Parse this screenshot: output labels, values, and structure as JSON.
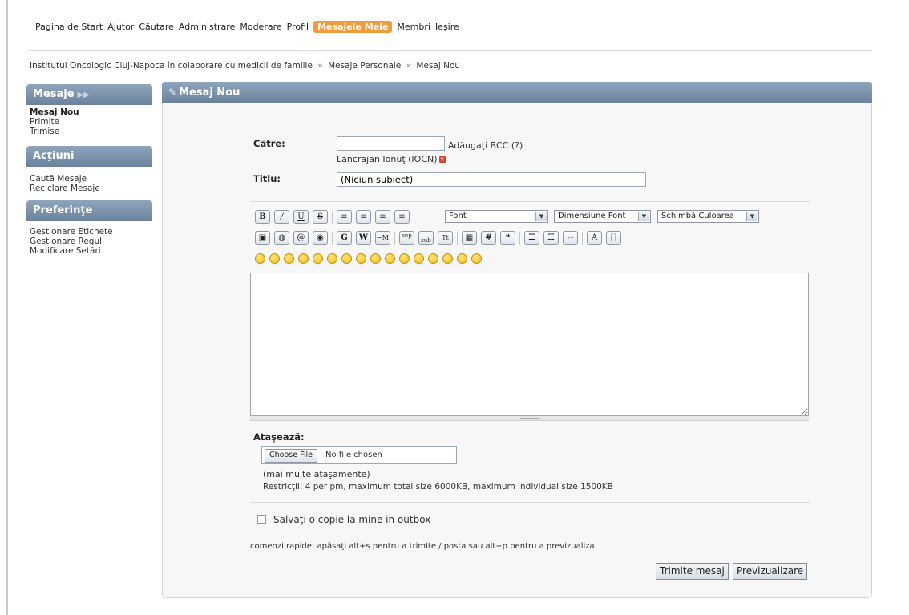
{
  "nav": {
    "items": [
      {
        "label": "Pagina de Start"
      },
      {
        "label": "Ajutor"
      },
      {
        "label": "Căutare"
      },
      {
        "label": "Administrare"
      },
      {
        "label": "Moderare"
      },
      {
        "label": "Profil"
      },
      {
        "label": "Mesajele Mele",
        "active": true
      },
      {
        "label": "Membri"
      },
      {
        "label": "Ieşire"
      }
    ],
    "accent_color": "#f39a3a"
  },
  "breadcrumb": {
    "items": [
      "Institutul Oncologic Cluj-Napoca în colaborare cu medicii de familie",
      "Mesaje Personale",
      "Mesaj Nou"
    ],
    "separator": "»"
  },
  "sidebar": {
    "sections": [
      {
        "title": "Mesaje",
        "items": [
          "Mesaj Nou",
          "Primite",
          "Trimise"
        ]
      },
      {
        "title": "Acţiuni",
        "items": [
          "Caută Mesaje",
          "Reciclare Mesaje"
        ]
      },
      {
        "title": "Preferinţe",
        "items": [
          "Gestionare Etichete",
          "Gestionare Reguli",
          "Modificare Setări"
        ]
      }
    ],
    "header_color": "#7d93ab"
  },
  "main": {
    "title": "Mesaj Nou",
    "to_label": "Către:",
    "to_value": "",
    "add_bcc": "Adăugaţi BCC (?)",
    "recipient": "Lăncrăjan Ionuţ (IOCN)",
    "subject_label": "Titlu:",
    "subject_value": "(Niciun subiect)",
    "toolbar": {
      "font_select": "Font",
      "size_select": "Dimensiune Font",
      "color_select": "Schimbă Culoarea"
    },
    "body_value": "",
    "attach_label": "Ataşează:",
    "choose_file": "Choose File",
    "no_file": "No file chosen",
    "more_attachments": "(mai multe ataşamente)",
    "restrictions": "Restricţii: 4 per pm, maximum total size 6000KB, maximum individual size 1500KB",
    "save_copy": "Salvaţi o copie la mine in outbox",
    "shortcuts": "comenzi rapide: apăsaţi alt+s pentru a trimite / posta sau alt+p pentru a previzualiza",
    "send_button": "Trimite mesaj",
    "preview_button": "Previzualizare"
  }
}
